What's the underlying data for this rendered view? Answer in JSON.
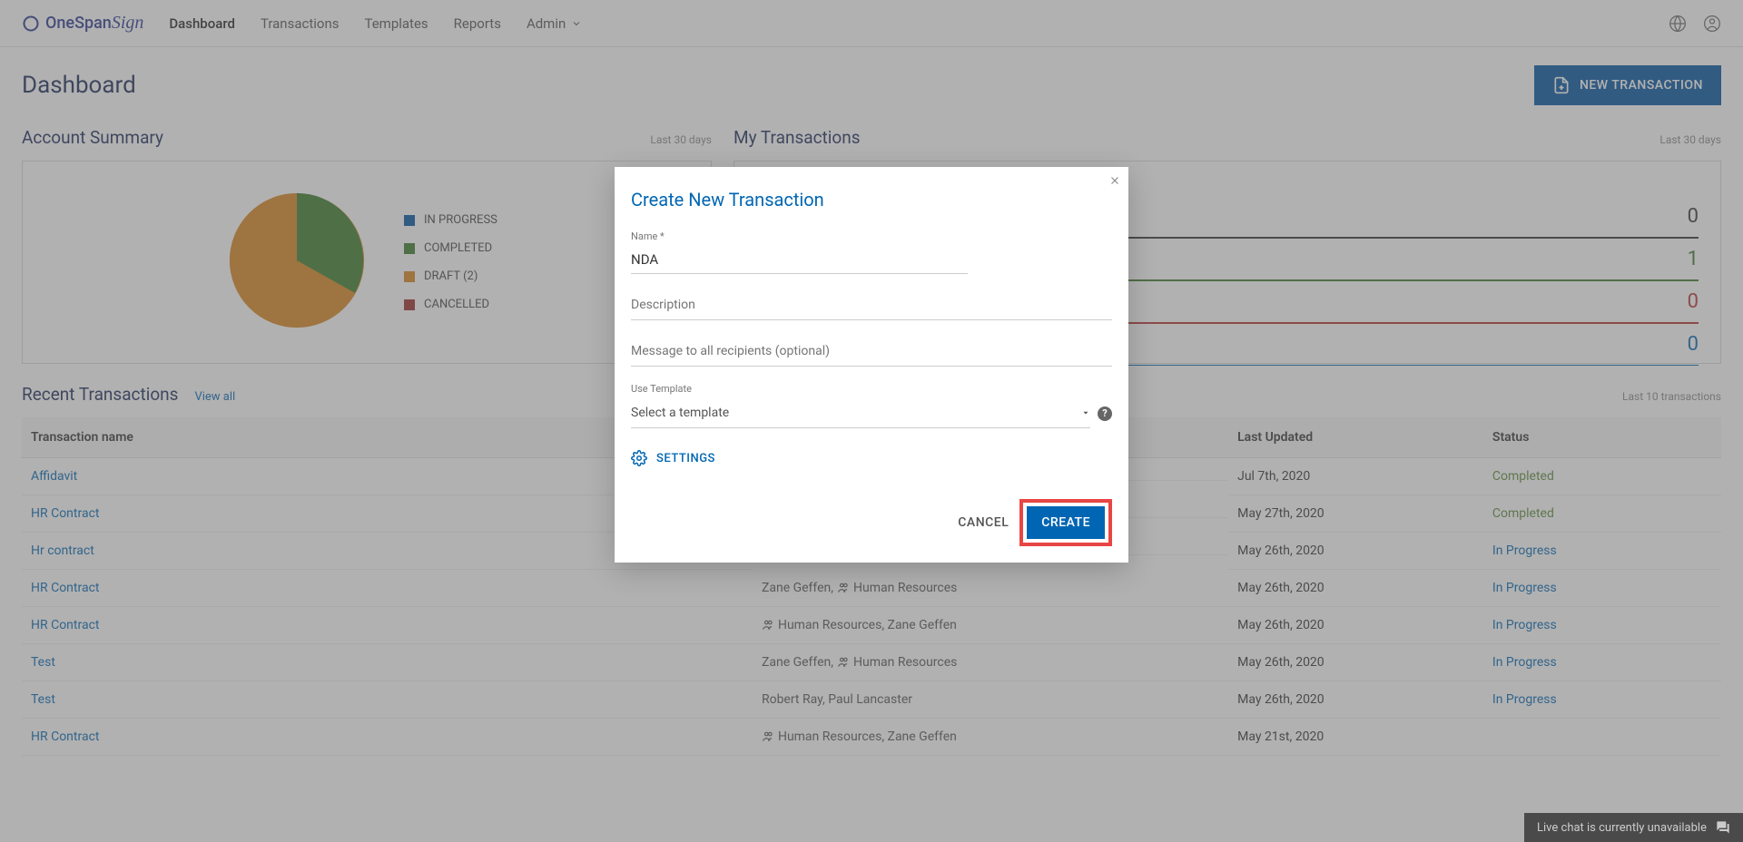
{
  "header": {
    "logo_text": "OneSpan",
    "logo_sign": "Sign",
    "nav": [
      {
        "label": "Dashboard",
        "active": true
      },
      {
        "label": "Transactions",
        "active": false
      },
      {
        "label": "Templates",
        "active": false
      },
      {
        "label": "Reports",
        "active": false
      },
      {
        "label": "Admin",
        "active": false,
        "dropdown": true
      }
    ]
  },
  "page": {
    "title": "Dashboard",
    "new_transaction_btn": "NEW TRANSACTION"
  },
  "account_summary": {
    "title": "Account Summary",
    "sub": "Last 30 days",
    "legend": [
      {
        "label": "IN PROGRESS",
        "color": "#0053a0"
      },
      {
        "label": "COMPLETED",
        "color": "#3a7a2a"
      },
      {
        "label": "DRAFT (2)",
        "color": "#d8851f"
      },
      {
        "label": "CANCELLED",
        "color": "#9c2b2b"
      }
    ]
  },
  "my_transactions": {
    "title": "My Transactions",
    "sub": "Last 30 days",
    "rows": [
      {
        "count": "0",
        "color": "#333"
      },
      {
        "count": "1",
        "color": "#3a7a2a"
      },
      {
        "count": "0",
        "color": "#b83030"
      },
      {
        "count": "0",
        "color": "#0066b3"
      }
    ]
  },
  "recent": {
    "title": "Recent Transactions",
    "view_all": "View all",
    "sub": "Last 10 transactions",
    "cols": {
      "name": "Transaction name",
      "recipients": "",
      "updated": "Last Updated",
      "status": "Status"
    },
    "rows": [
      {
        "name": "Affidavit",
        "recipients": "",
        "updated": "Jul 7th, 2020",
        "status": "Completed",
        "status_class": "completed"
      },
      {
        "name": "HR Contract",
        "recipients": "",
        "updated": "May 27th, 2020",
        "status": "Completed",
        "status_class": "completed"
      },
      {
        "name": "Hr contract",
        "recipients": "",
        "updated": "May 26th, 2020",
        "status": "In Progress",
        "status_class": "inprogress"
      },
      {
        "name": "HR Contract",
        "recipients": "Zane Geffen, Human Resources",
        "icons": "person-group",
        "updated": "May 26th, 2020",
        "status": "In Progress",
        "status_class": "inprogress"
      },
      {
        "name": "HR Contract",
        "recipients": "Human Resources, Zane Geffen",
        "icons": "group",
        "updated": "May 26th, 2020",
        "status": "In Progress",
        "status_class": "inprogress"
      },
      {
        "name": "Test",
        "recipients": "Zane Geffen, Human Resources",
        "icons": "person-group",
        "updated": "May 26th, 2020",
        "status": "In Progress",
        "status_class": "inprogress"
      },
      {
        "name": "Test",
        "recipients": "Robert Ray, Paul Lancaster",
        "icons": "",
        "updated": "May 26th, 2020",
        "status": "In Progress",
        "status_class": "inprogress"
      },
      {
        "name": "HR Contract",
        "recipients": "Human Resources, Zane Geffen",
        "icons": "group",
        "updated": "May 21st, 2020",
        "status": "",
        "status_class": ""
      }
    ]
  },
  "modal": {
    "title": "Create New Transaction",
    "name_label": "Name *",
    "name_value": "NDA",
    "description_label": "Description",
    "message_label": "Message to all recipients (optional)",
    "template_label": "Use Template",
    "template_placeholder": "Select a template",
    "settings_label": "SETTINGS",
    "cancel_label": "CANCEL",
    "create_label": "CREATE"
  },
  "chat": {
    "text": "Live chat is currently unavailable"
  },
  "chart_data": {
    "type": "pie",
    "title": "Account Summary",
    "categories": [
      "In Progress",
      "Completed",
      "Draft",
      "Cancelled"
    ],
    "values": [
      0,
      30,
      70,
      0
    ],
    "colors": [
      "#0053a0",
      "#3a7a2a",
      "#d8851f",
      "#9c2b2b"
    ]
  }
}
